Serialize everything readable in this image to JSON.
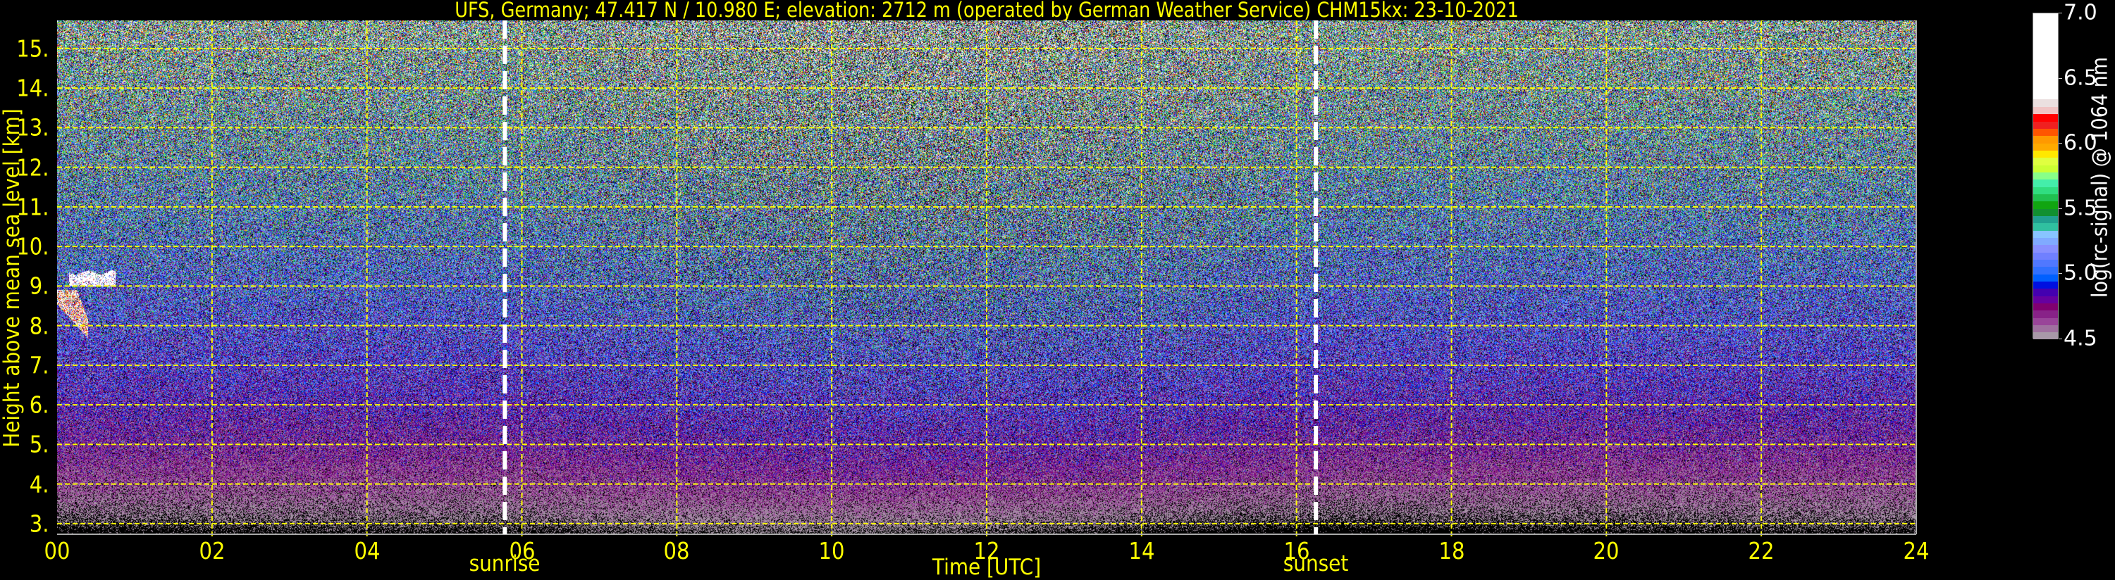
{
  "chart_data": {
    "type": "heatmap",
    "title": "UFS, Germany; 47.417 N / 10.980 E; elevation: 2712 m  (operated by German Weather Service)    CHM15kx: 23-10-2021",
    "xlabel": "Time [UTC]",
    "ylabel": "Height above mean sea level [km]",
    "xlim": [
      0,
      24
    ],
    "ylim": [
      2.73,
      15.71
    ],
    "grid": true,
    "x_ticks": [
      0,
      2,
      4,
      6,
      8,
      10,
      12,
      14,
      16,
      18,
      20,
      22,
      24
    ],
    "x_tick_labels": [
      "00",
      "02",
      "04",
      "06",
      "08",
      "10",
      "12",
      "14",
      "16",
      "18",
      "20",
      "22",
      "24"
    ],
    "y_ticks": [
      3,
      4,
      5,
      6,
      7,
      8,
      9,
      10,
      11,
      12,
      13,
      14,
      15
    ],
    "y_tick_labels": [
      "3.",
      "4.",
      "5.",
      "6.",
      "7.",
      "8.",
      "9.",
      "10.",
      "11.",
      "12.",
      "13.",
      "14.",
      "15."
    ],
    "annotations": [
      {
        "label": "sunrise",
        "x": 5.78
      },
      {
        "label": "sunset",
        "x": 16.25
      }
    ],
    "features": [
      {
        "type": "cloud",
        "t_range": [
          0.15,
          0.75
        ],
        "h_range": [
          9.0,
          9.35
        ],
        "value": 6.6
      },
      {
        "type": "cloud",
        "t_range": [
          0.0,
          0.4
        ],
        "h_range": [
          7.4,
          8.9
        ],
        "value": 6.3
      }
    ],
    "colorbar": {
      "label": "log(rc-signal) @ 1064 nm",
      "range": [
        4.5,
        7.0
      ],
      "ticks": [
        4.5,
        5.0,
        5.5,
        6.0,
        6.5,
        7.0
      ],
      "tick_labels": [
        "4.5",
        "5.0",
        "5.5",
        "6.0",
        "6.5",
        "7.0"
      ],
      "white_above": 6.34,
      "colors": [
        "#a898a8",
        "#a070a0",
        "#994499",
        "#882288",
        "#800070",
        "#6600a0",
        "#4400b0",
        "#0010e0",
        "#0060ff",
        "#3070ff",
        "#5078ff",
        "#7080ff",
        "#8890ff",
        "#80aaff",
        "#88c4ff",
        "#30c0a0",
        "#20a090",
        "#119030",
        "#11a511",
        "#20c050",
        "#30dd80",
        "#44eeaa",
        "#88ff88",
        "#ccff33",
        "#e0ff40",
        "#ffe800",
        "#ffaa00",
        "#ff9900",
        "#ff5500",
        "#f02020",
        "#ff0000",
        "#f0c4c4",
        "#ebe0e0"
      ],
      "top_color": "#ffffff"
    },
    "text_color": "#ffff00",
    "grid_color": "#ffff00",
    "marker_color": "#ffffff"
  }
}
